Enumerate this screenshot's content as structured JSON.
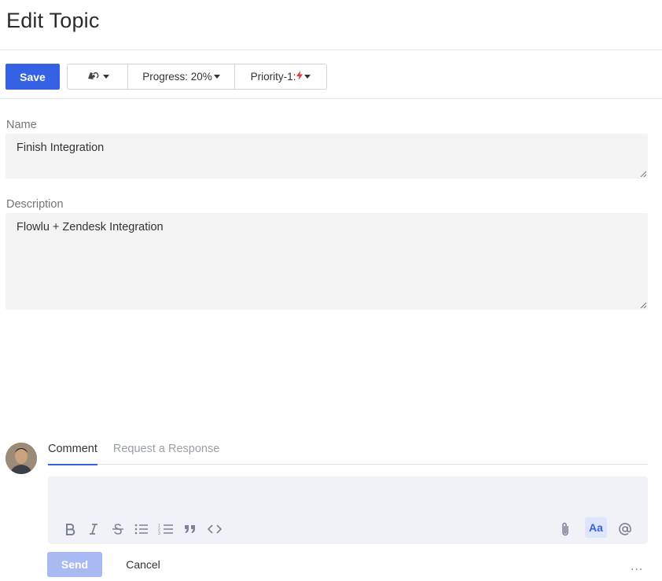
{
  "page": {
    "title": "Edit Topic"
  },
  "toolbar": {
    "save_label": "Save",
    "responsible_icon": "assignee-icon",
    "progress_label": "Progress: 20%",
    "priority_label": "Priority-1:",
    "priority_icon": "lightning-icon",
    "priority_color": "#e53935"
  },
  "form": {
    "name_label": "Name",
    "name_value": "Finish Integration",
    "description_label": "Description",
    "description_value": "Flowlu + Zendesk Integration"
  },
  "comment": {
    "tabs": [
      {
        "label": "Comment",
        "active": true
      },
      {
        "label": "Request a Response",
        "active": false
      }
    ],
    "format_buttons": [
      "bold-icon",
      "italic-icon",
      "strikethrough-icon",
      "bullet-list-icon",
      "numbered-list-icon",
      "quote-icon",
      "code-icon"
    ],
    "right_buttons": [
      "attachment-icon",
      "text-format-icon",
      "mention-icon"
    ],
    "text_format_label": "Aa",
    "send_label": "Send",
    "cancel_label": "Cancel",
    "more_label": "..."
  },
  "colors": {
    "accent": "#3561e4",
    "send_disabled": "#a9b9f2"
  }
}
